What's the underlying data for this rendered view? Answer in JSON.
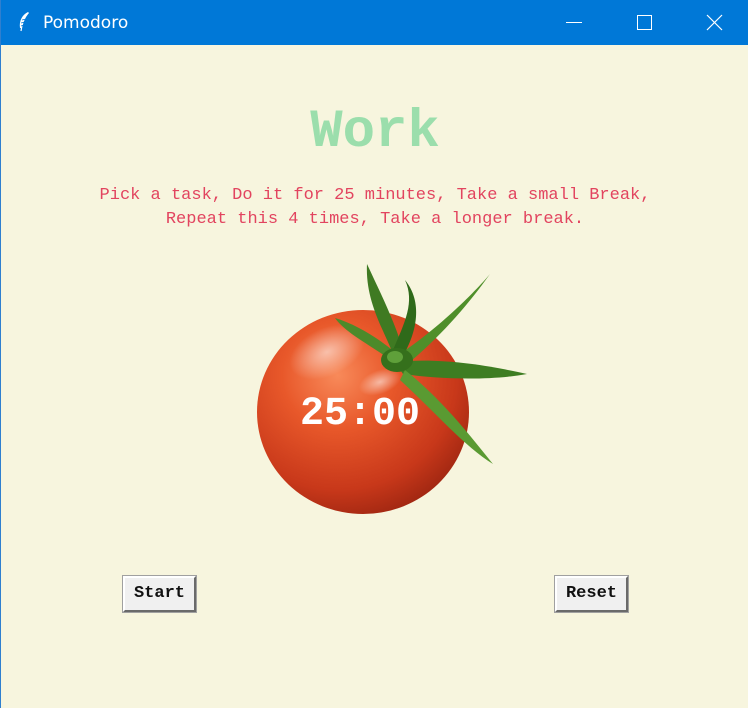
{
  "window": {
    "title": "Pomodoro",
    "controls": [
      "minimize",
      "maximize",
      "close"
    ],
    "titlebar_color": "#0078d7",
    "background_color": "#f7f5de"
  },
  "main": {
    "heading": "Work",
    "heading_color": "#9bdeac",
    "instructions": {
      "line1": "Pick a task, Do it for 25 minutes, Take a small Break,",
      "line2": "Repeat this 4 times, Take a longer break.",
      "color": "#e2445f"
    },
    "tomato_icon": "tomato-image",
    "timer": "25:00"
  },
  "buttons": {
    "start_label": "Start",
    "reset_label": "Reset"
  }
}
